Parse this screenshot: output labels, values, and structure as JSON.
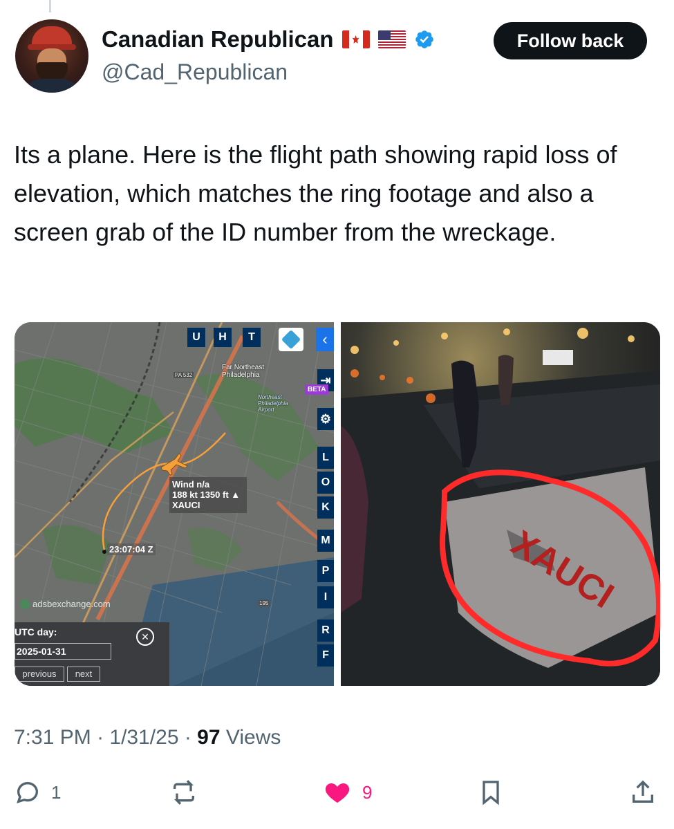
{
  "author": {
    "display_name": "Canadian Republican",
    "flag_icons": [
      "canada-flag-icon",
      "usa-flag-icon"
    ],
    "handle": "@Cad_Republican",
    "verified": true
  },
  "follow_button": "Follow back",
  "tweet_text": "Its a plane. Here is the flight path showing rapid loss of elevation, which matches the ring footage and also a screen grab of the ID number from the wreckage.",
  "map": {
    "top_buttons": [
      "U",
      "H",
      "T"
    ],
    "side_buttons": [
      "L",
      "O",
      "K",
      "M",
      "P",
      "I",
      "R",
      "F"
    ],
    "beta_badge": "BETA",
    "place_labels": {
      "far_northeast": "Far Northeast\nPhiladelphia",
      "airport": "Northeast\nPhiladelphia\nAirport",
      "pa532": "PA 532",
      "i95": "195"
    },
    "wind_info": {
      "wind": "Wind n/a",
      "speed_alt": "188 kt  1350 ft",
      "callsign": "XAUCI"
    },
    "timestamp": "23:07:04 Z",
    "watermark": "adsbexchange.com",
    "utc_label": "UTC day:",
    "utc_value": "2025-01-31",
    "previous_label": "previous",
    "next_label": "next"
  },
  "meta": {
    "time": "7:31 PM",
    "date": "1/31/25",
    "views_count": "97",
    "views_label": "Views"
  },
  "actions": {
    "replies": "1",
    "reposts": "",
    "likes": "9"
  },
  "colors": {
    "follow_bg": "#0f1419",
    "like_pink": "#f91880",
    "verified_blue": "#1d9bf0",
    "flight_path": "#f5a03a",
    "highlight_red": "#ff2a2a"
  }
}
